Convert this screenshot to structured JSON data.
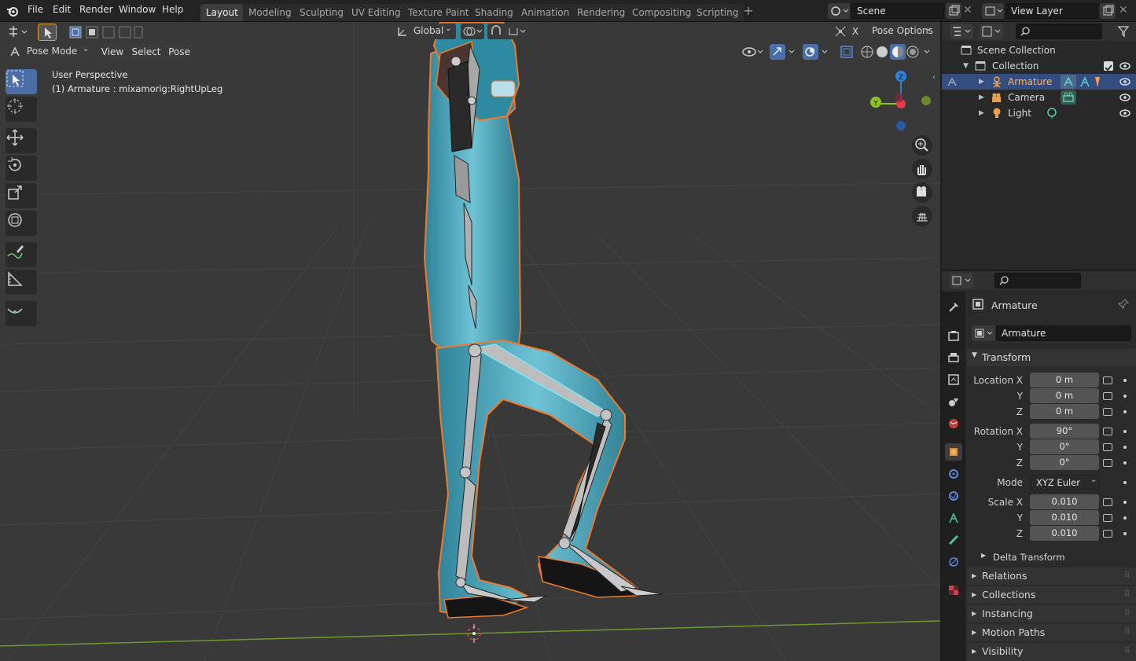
{
  "menu": [
    "File",
    "Edit",
    "Render",
    "Window",
    "Help"
  ],
  "workspaces": [
    "Layout",
    "Modeling",
    "Sculpting",
    "UV Editing",
    "Texture Paint",
    "Shading",
    "Animation",
    "Rendering",
    "Compositing",
    "Scripting"
  ],
  "active_workspace": "Layout",
  "scene": {
    "name": "Scene",
    "view_layer": "View Layer"
  },
  "header": {
    "mode": "Pose Mode",
    "view": "View",
    "select": "Select",
    "pose": "Pose",
    "orientation": "Global",
    "pose_options": "Pose Options",
    "x_mirror": "X"
  },
  "viewport": {
    "perspective": "User Perspective",
    "active": "(1) Armature : mixamorig:RightUpLeg",
    "gizmo": {
      "x": "X",
      "y": "Y",
      "z": "Z"
    }
  },
  "outliner": {
    "root": "Scene Collection",
    "collection": "Collection",
    "items": [
      {
        "name": "Armature",
        "selected": true
      },
      {
        "name": "Camera",
        "selected": false
      },
      {
        "name": "Light",
        "selected": false
      }
    ]
  },
  "properties": {
    "object_name": "Armature",
    "name_field": "Armature",
    "transform_label": "Transform",
    "location": {
      "label": "Location X",
      "x": "0 m",
      "y": "0 m",
      "z": "0 m"
    },
    "rotation": {
      "label": "Rotation X",
      "x": "90°",
      "y": "0°",
      "z": "0°"
    },
    "mode_label": "Mode",
    "mode_value": "XYZ Euler",
    "scale": {
      "label": "Scale X",
      "x": "0.010",
      "y": "0.010",
      "z": "0.010"
    },
    "axis_y": "Y",
    "axis_z": "Z",
    "delta_transform": "Delta Transform",
    "panels": [
      "Relations",
      "Collections",
      "Instancing",
      "Motion Paths",
      "Visibility"
    ]
  },
  "colors": {
    "accent": "#4a6fa8",
    "selection_outline": "#f07a2a",
    "x_axis": "#e23b4a",
    "y_axis": "#8dc21f",
    "z_axis": "#2e7fe0",
    "mesh": "#3f9fb5"
  }
}
